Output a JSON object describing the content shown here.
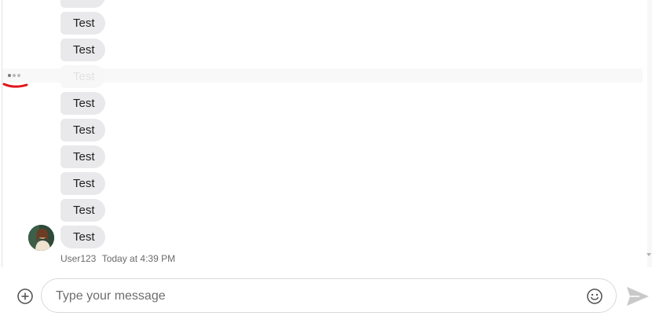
{
  "messages": [
    {
      "text": "Test"
    },
    {
      "text": "Test"
    },
    {
      "text": "Test"
    },
    {
      "text": "Test"
    },
    {
      "text": "Test"
    },
    {
      "text": "Test"
    },
    {
      "text": "Test"
    },
    {
      "text": "Test"
    },
    {
      "text": "Test"
    },
    {
      "text": "Test"
    }
  ],
  "meta": {
    "user": "User123",
    "timestamp": "Today at 4:39 PM"
  },
  "composer": {
    "placeholder": "Type your message"
  },
  "icons": {
    "add": "plus-circle-icon",
    "emoji": "smiley-icon",
    "send": "paper-plane-icon",
    "more": "more-dots-icon",
    "annotation": "red-underline-mark"
  },
  "colors": {
    "bubble": "#e9e9ec",
    "annotation": "#e0141c",
    "send": "#c9c9c9"
  }
}
